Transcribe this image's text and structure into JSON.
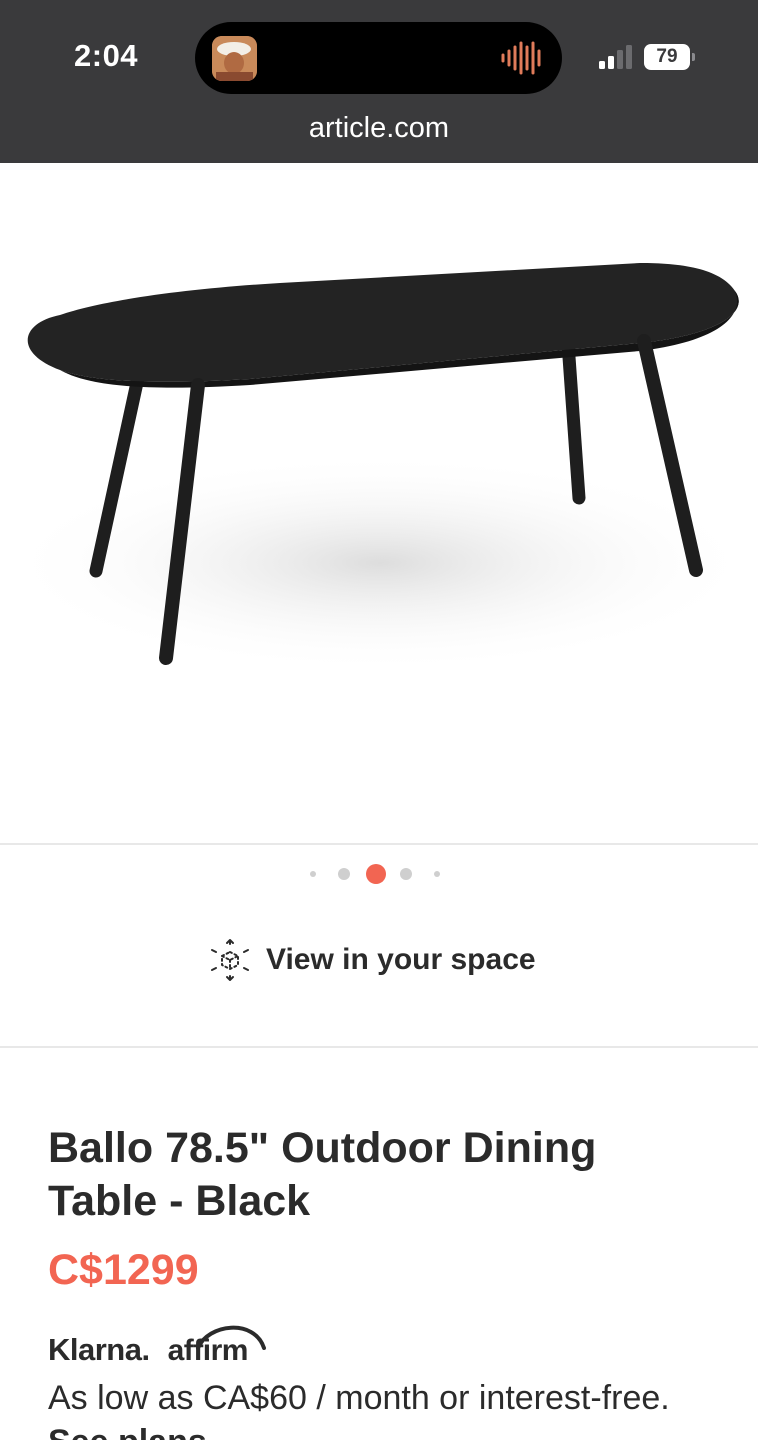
{
  "status_bar": {
    "time": "2:04",
    "battery": "79",
    "icons": [
      "now-playing-avatar",
      "audio-waveform-icon",
      "cellular-signal-icon",
      "battery-icon"
    ]
  },
  "browser": {
    "url": "article.com"
  },
  "gallery": {
    "image_description_icon": "outdoor-table-image",
    "dots": [
      {
        "state": "small"
      },
      {
        "state": "medium"
      },
      {
        "state": "active"
      },
      {
        "state": "medium"
      },
      {
        "state": "small"
      }
    ],
    "active_index": 2,
    "active_color": "#f26552"
  },
  "ar_button": {
    "label": "View in your space",
    "icon": "ar-cube-icon"
  },
  "product": {
    "title": "Ballo 78.5\" Outdoor Dining Table - Black",
    "price": "C$1299",
    "price_color": "#f26552"
  },
  "payment": {
    "klarna": "Klarna.",
    "affirm": "affirm",
    "financing_text": "As low as CA$60 / month or interest-free.",
    "see_plans": "See plans"
  }
}
